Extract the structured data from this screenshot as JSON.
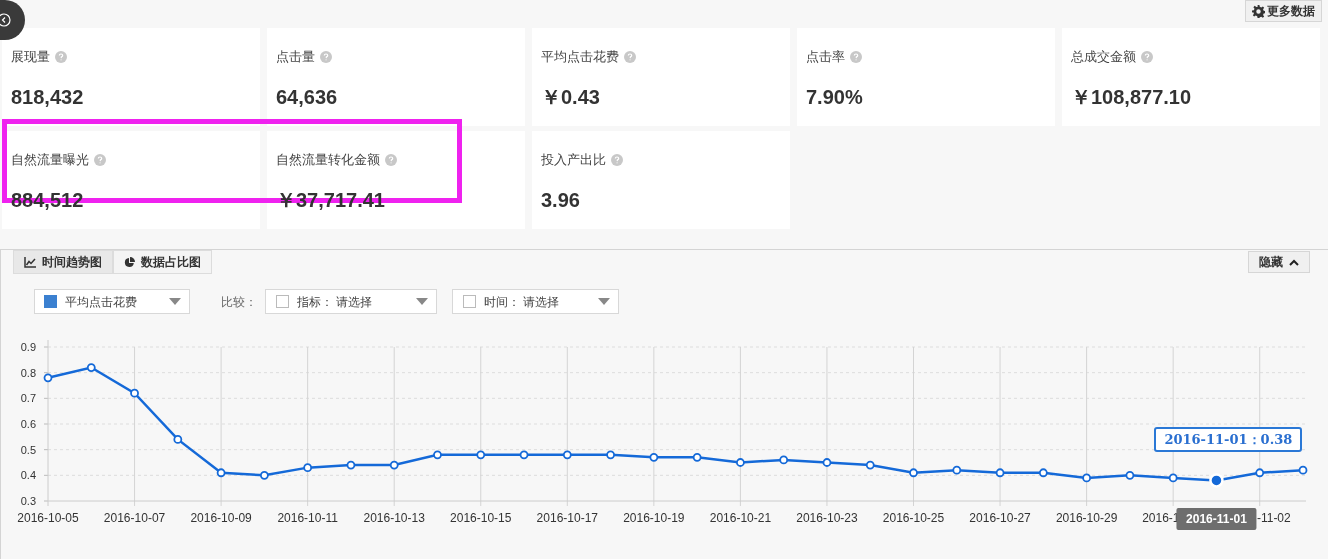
{
  "top_bar": {
    "more_button": "更多数据"
  },
  "metrics": [
    {
      "label": "展现量",
      "value": "818,432"
    },
    {
      "label": "点击量",
      "value": "64,636"
    },
    {
      "label": "平均点击花费",
      "value": "￥0.43"
    },
    {
      "label": "点击率",
      "value": "7.90%"
    },
    {
      "label": "总成交金额",
      "value": "￥108,877.10"
    },
    {
      "label": "自然流量曝光",
      "value": "884,512"
    },
    {
      "label": "自然流量转化金额",
      "value": "￥37,717.41"
    },
    {
      "label": "投入产出比",
      "value": "3.96"
    }
  ],
  "chart_panel": {
    "tabs": [
      {
        "label": "时间趋势图",
        "kind": "line",
        "selected": true
      },
      {
        "label": "数据占比图",
        "kind": "pie",
        "selected": false
      }
    ],
    "hide_button": "隐藏",
    "metric_select": {
      "value": "平均点击花费",
      "color": "#3b80d0"
    },
    "compare_label": "比较：",
    "compare_filters": [
      {
        "label": "指标：",
        "value": "请选择",
        "checked": false
      },
      {
        "label": "时间：",
        "value": "请选择",
        "checked": false
      }
    ],
    "chart_data": {
      "type": "line",
      "categories": [
        "2016-10-05",
        null,
        "2016-10-07",
        null,
        "2016-10-09",
        null,
        "2016-10-11",
        null,
        "2016-10-13",
        null,
        "2016-10-15",
        null,
        "2016-10-17",
        null,
        "2016-10-19",
        null,
        "2016-10-21",
        null,
        "2016-10-23",
        null,
        "2016-10-25",
        null,
        "2016-10-27",
        null,
        "2016-10-29",
        null,
        null,
        "2016-11-01",
        null,
        null
      ],
      "grid": true,
      "series": [
        {
          "color": "#1469d8",
          "marker": "circle",
          "values": [
            0.78,
            0.82,
            0.72,
            0.54,
            0.41,
            0.4,
            0.43,
            0.44,
            0.44,
            0.48,
            0.48,
            0.48,
            0.48,
            0.48,
            0.47,
            0.47,
            0.45,
            0.46,
            0.45,
            0.44,
            0.41,
            0.42,
            0.41,
            0.41,
            0.39,
            0.4,
            0.39,
            0.38,
            0.41,
            0.42
          ]
        }
      ],
      "ylim": [
        0.3,
        0.9
      ],
      "yticks": [
        0.3,
        0.4,
        0.5,
        0.6,
        0.7,
        0.8,
        0.9
      ],
      "annotations": [
        {
          "x": "2016-11-01",
          "y": 0.38,
          "text": "2016-11-01：0.38"
        }
      ]
    },
    "covered_tick_labels": [
      "2016-1",
      "-11-02"
    ]
  }
}
